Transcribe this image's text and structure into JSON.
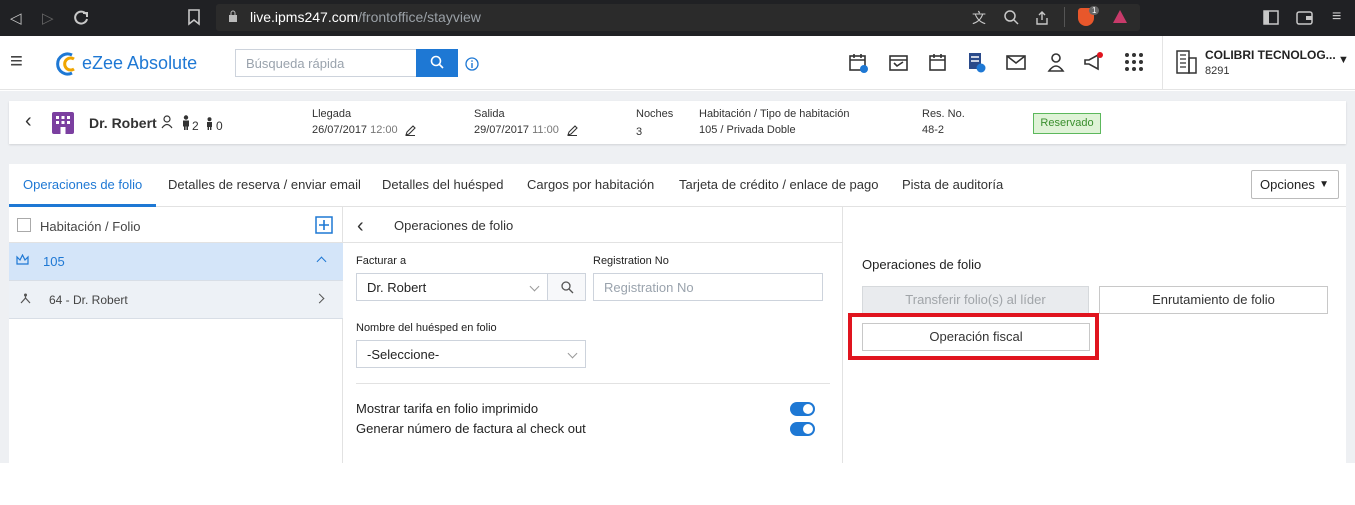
{
  "browser": {
    "url_domain": "live.ipms247.com",
    "url_path": "/frontoffice/stayview",
    "badge_count": "1"
  },
  "app": {
    "logo_text": "eZee Absolute",
    "search_placeholder": "Búsqueda rápida",
    "company_name": "COLIBRI TECNOLOG...",
    "company_code": "8291"
  },
  "guest": {
    "name": "Dr. Robert",
    "adults": "2",
    "children": "0",
    "arrival_label": "Llegada",
    "arrival_date": "26/07/2017",
    "arrival_time": "12:00",
    "departure_label": "Salida",
    "departure_date": "29/07/2017",
    "departure_time": "11:00",
    "nights_label": "Noches",
    "nights": "3",
    "room_label": "Habitación / Tipo de habitación",
    "room": "105 / Privada Doble",
    "res_label": "Res. No.",
    "res_no": "48-2",
    "status": "Reservado"
  },
  "tabs": [
    {
      "label": "Operaciones de folio"
    },
    {
      "label": "Detalles de reserva / enviar email"
    },
    {
      "label": "Detalles del huésped"
    },
    {
      "label": "Cargos por habitación"
    },
    {
      "label": "Tarjeta de crédito / enlace de pago"
    },
    {
      "label": "Pista de auditoría"
    }
  ],
  "options_label": "Opciones",
  "left_panel": {
    "header": "Habitación / Folio",
    "room": "105",
    "folio": "64 - Dr. Robert"
  },
  "middle_panel": {
    "title": "Operaciones de folio",
    "bill_to_label": "Facturar a",
    "bill_to_value": "Dr. Robert",
    "registration_label": "Registration No",
    "registration_placeholder": "Registration No",
    "guest_name_label": "Nombre del huésped en folio",
    "guest_name_value": "-Seleccione-",
    "toggle1_label": "Mostrar tarifa en folio imprimido",
    "toggle2_label": "Generar número de factura al check out",
    "toggle1_on": true,
    "toggle2_on": true
  },
  "right_panel": {
    "title": "Operaciones de folio",
    "transfer_label": "Transferir folio(s) al líder",
    "routing_label": "Enrutamiento de folio",
    "fiscal_label": "Operación fiscal"
  },
  "colors": {
    "accent": "#1e78d4",
    "highlight": "#e0141e",
    "status_green": "#5cb85c"
  }
}
